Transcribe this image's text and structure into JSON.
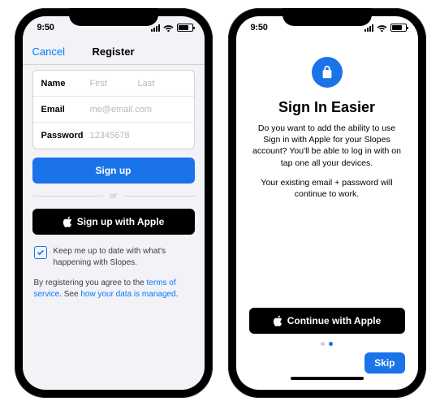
{
  "status": {
    "time": "9:50"
  },
  "left": {
    "nav": {
      "cancel": "Cancel",
      "title": "Register"
    },
    "form": {
      "name_label": "Name",
      "first_ph": "First",
      "last_ph": "Last",
      "email_label": "Email",
      "email_ph": "me@email.com",
      "password_label": "Password",
      "password_ph": "12345678"
    },
    "signup_btn": "Sign up",
    "separator": "or",
    "apple_btn": "Sign up with Apple",
    "checkbox_label": "Keep me up to date with what's happening with Slopes.",
    "terms_prefix": "By registering you agree to the ",
    "terms_link": "terms of service",
    "terms_mid": ". See ",
    "data_link": "how your data is managed",
    "terms_suffix": "."
  },
  "right": {
    "headline": "Sign In Easier",
    "body1": "Do you want to add the ability to use Sign in with Apple for your Slopes account? You'll be able to log in with on tap one all your devices.",
    "body2": "Your existing email + password will continue to work.",
    "continue_btn": "Continue with Apple",
    "skip_btn": "Skip"
  }
}
